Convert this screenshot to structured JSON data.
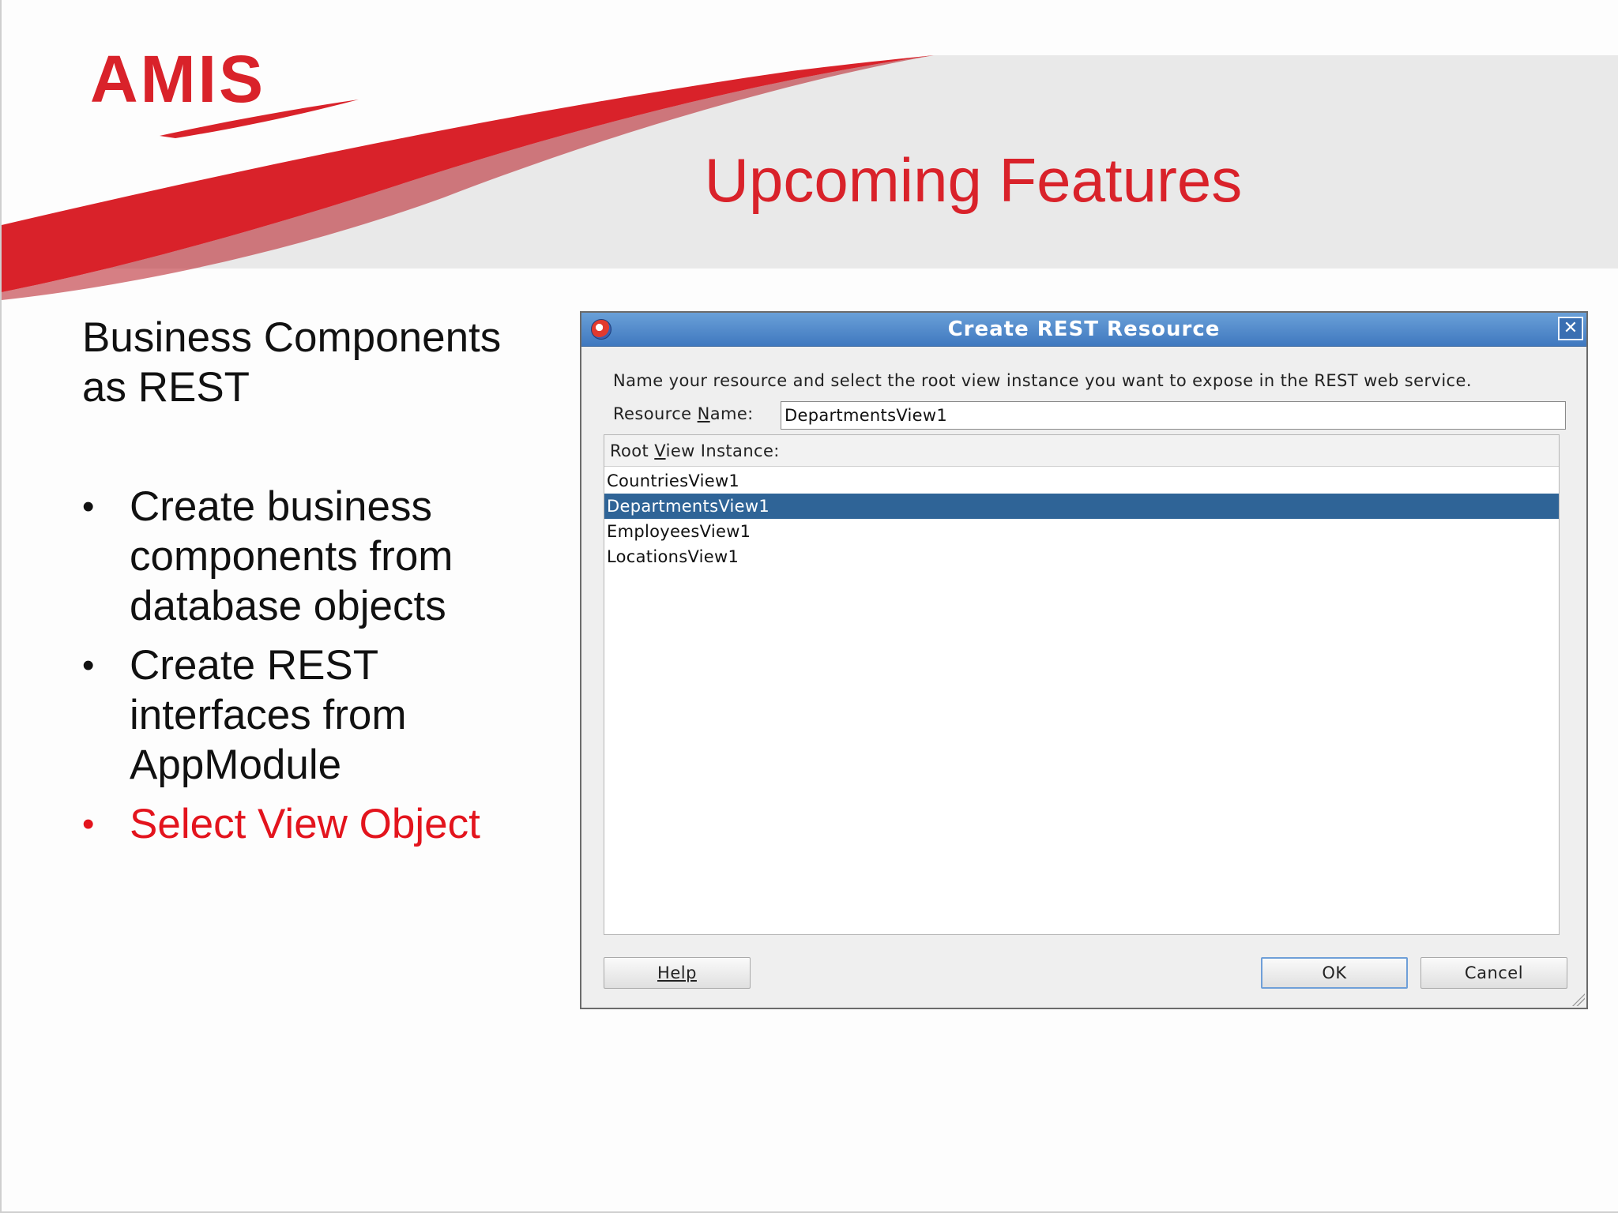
{
  "slide": {
    "logo": "AMIS",
    "title": "Upcoming Features",
    "heading_line1": "Business Components",
    "heading_line2": "as REST",
    "bullets": [
      {
        "lines": [
          "Create business",
          "components from",
          "database objects"
        ]
      },
      {
        "lines": [
          "Create REST",
          "interfaces from",
          "AppModule"
        ]
      },
      {
        "lines": [
          "Select View Object"
        ]
      }
    ],
    "bullet_glyph": "•",
    "colors": {
      "accent": "#d9222a",
      "active_bullet": "#e3141d"
    }
  },
  "dialog": {
    "title": "Create REST Resource",
    "close_glyph": "✕",
    "description": "Name your resource and select the root view instance you want to expose in the REST web service.",
    "resource_name_label": "Resource Name:",
    "resource_name_value": "DepartmentsView1",
    "list_header": "Root View Instance:",
    "items": [
      "CountriesView1",
      "DepartmentsView1",
      "EmployeesView1",
      "LocationsView1"
    ],
    "selected_item": "DepartmentsView1",
    "help_label": "Help",
    "ok_label": "OK",
    "cancel_label": "Cancel",
    "colors": {
      "titlebar": "#4a84c8",
      "selection": "#2f6497"
    }
  }
}
